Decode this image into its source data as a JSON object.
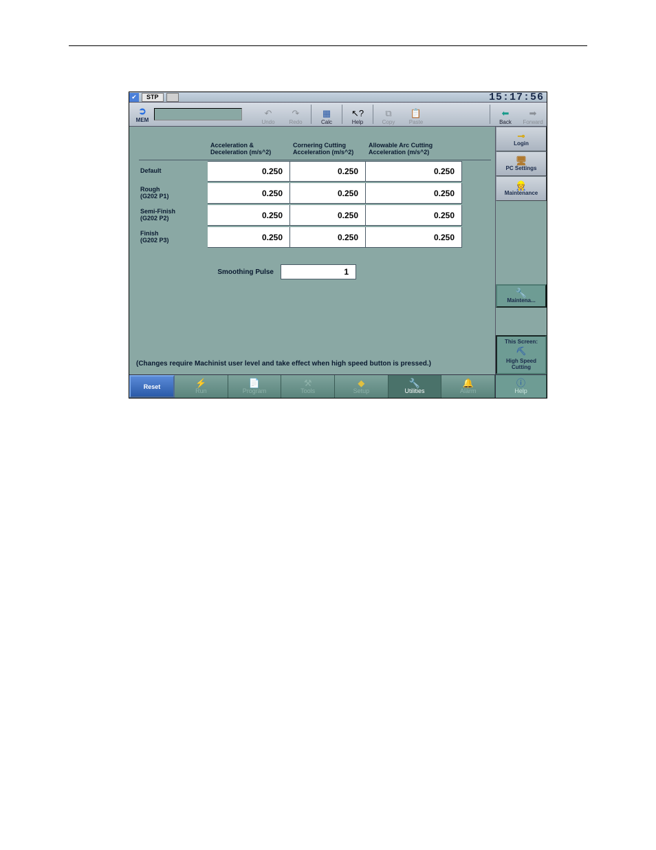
{
  "topbar": {
    "stp_label": "STP",
    "clock": "15:17:56"
  },
  "toolbar": {
    "mem_label": "MEM",
    "undo": "Undo",
    "redo": "Redo",
    "calc": "Calc",
    "help": "Help",
    "copy": "Copy",
    "paste": "Paste",
    "back": "Back",
    "forward": "Forward"
  },
  "side": {
    "login": "Login",
    "pc_settings": "PC Settings",
    "maintenance": "Maintenance",
    "maintena_btn": "Maintena...",
    "this_screen_title": "This Screen:",
    "this_screen_name": "High Speed Cutting"
  },
  "params": {
    "col_headers": {
      "accel": "Acceleration & Deceleration (m/s^2)",
      "corner": "Cornering Cutting Acceleration (m/s^2)",
      "arc": "Allowable Arc Cutting Acceleration (m/s^2)"
    },
    "rows": [
      {
        "label": "Default",
        "sub": "",
        "accel": "0.250",
        "corner": "0.250",
        "arc": "0.250"
      },
      {
        "label": "Rough",
        "sub": "(G202 P1)",
        "accel": "0.250",
        "corner": "0.250",
        "arc": "0.250"
      },
      {
        "label": "Semi-Finish",
        "sub": "(G202 P2)",
        "accel": "0.250",
        "corner": "0.250",
        "arc": "0.250"
      },
      {
        "label": "Finish",
        "sub": "(G202 P3)",
        "accel": "0.250",
        "corner": "0.250",
        "arc": "0.250"
      }
    ],
    "smoothing_label": "Smoothing Pulse",
    "smoothing_value": "1",
    "note": "(Changes require Machinist user level and take effect when high speed button is pressed.)"
  },
  "nav": {
    "reset": "Reset",
    "run": "Run",
    "program": "Program",
    "tools": "Tools",
    "setup": "Setup",
    "utilities": "Utilities",
    "alarm": "Alarm",
    "help": "Help"
  }
}
